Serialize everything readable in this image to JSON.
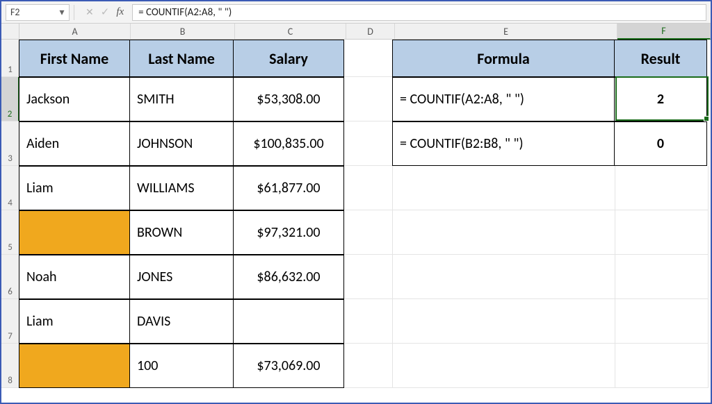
{
  "formula_bar": {
    "cell_ref": "F2",
    "formula": "= COUNTIF(A2:A8, \" \")"
  },
  "columns": {
    "A": "A",
    "B": "B",
    "C": "C",
    "D": "D",
    "E": "E",
    "F": "F"
  },
  "row_nums": [
    "1",
    "2",
    "3",
    "4",
    "5",
    "6",
    "7",
    "8"
  ],
  "left_table": {
    "headers": {
      "a": "First Name",
      "b": "Last Name",
      "c": "Salary"
    },
    "rows": [
      {
        "a": "Jackson",
        "b": "SMITH",
        "c": "$53,308.00",
        "a_orange": false
      },
      {
        "a": "Aiden",
        "b": "JOHNSON",
        "c": "$100,835.00",
        "a_orange": false
      },
      {
        "a": "Liam",
        "b": "WILLIAMS",
        "c": "$61,877.00",
        "a_orange": false
      },
      {
        "a": "",
        "b": "BROWN",
        "c": "$97,321.00",
        "a_orange": true
      },
      {
        "a": "Noah",
        "b": "JONES",
        "c": "$86,632.00",
        "a_orange": false
      },
      {
        "a": "Liam",
        "b": "DAVIS",
        "c": "",
        "a_orange": false
      },
      {
        "a": "",
        "b": "100",
        "c": "$73,069.00",
        "a_orange": true
      }
    ]
  },
  "right_table": {
    "headers": {
      "e": "Formula",
      "f": "Result"
    },
    "rows": [
      {
        "e": "= COUNTIF(A2:A8, \" \")",
        "f": "2"
      },
      {
        "e": "= COUNTIF(B2:B8, \" \")",
        "f": "0"
      }
    ]
  },
  "chart_data": {
    "type": "table",
    "tables": [
      {
        "name": "left",
        "columns": [
          "First Name",
          "Last Name",
          "Salary"
        ],
        "rows": [
          [
            "Jackson",
            "SMITH",
            "$53,308.00"
          ],
          [
            "Aiden",
            "JOHNSON",
            "$100,835.00"
          ],
          [
            "Liam",
            "WILLIAMS",
            "$61,877.00"
          ],
          [
            "",
            "BROWN",
            "$97,321.00"
          ],
          [
            "Noah",
            "JONES",
            "$86,632.00"
          ],
          [
            "Liam",
            "DAVIS",
            ""
          ],
          [
            "",
            "100",
            "$73,069.00"
          ]
        ]
      },
      {
        "name": "right",
        "columns": [
          "Formula",
          "Result"
        ],
        "rows": [
          [
            "= COUNTIF(A2:A8, \" \")",
            2
          ],
          [
            "= COUNTIF(B2:B8, \" \")",
            0
          ]
        ]
      }
    ]
  }
}
